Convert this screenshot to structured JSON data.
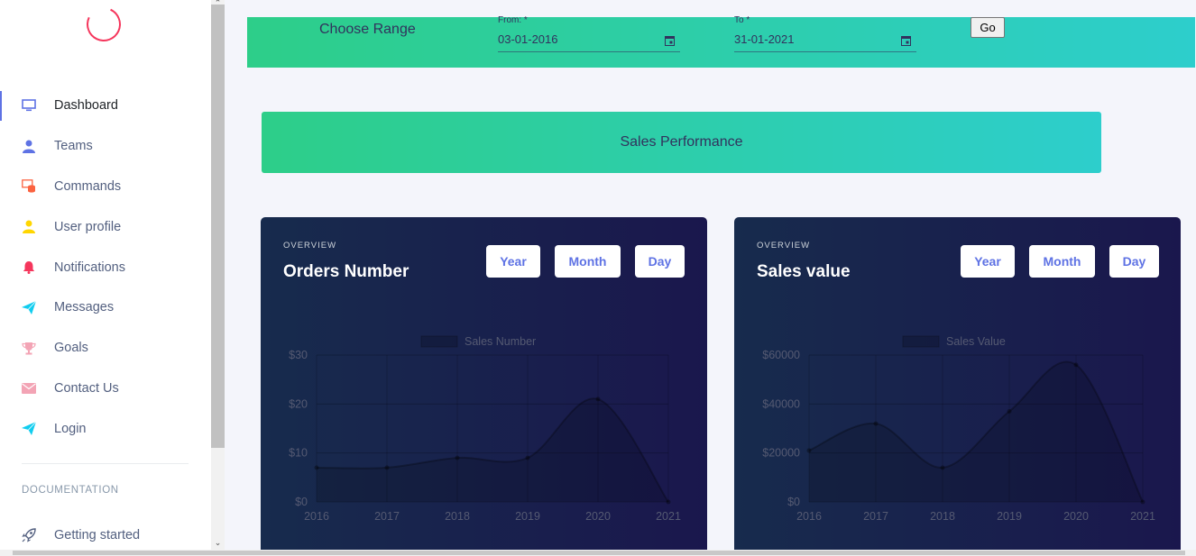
{
  "sidebar": {
    "items": [
      {
        "label": "Dashboard",
        "icon": "tv-icon",
        "color": "#5e72e4",
        "active": true
      },
      {
        "label": "Teams",
        "icon": "user-icon",
        "color": "#5e72e4"
      },
      {
        "label": "Commands",
        "icon": "database-icon",
        "color": "#fb6340"
      },
      {
        "label": "User profile",
        "icon": "user-icon",
        "color": "#ffd600"
      },
      {
        "label": "Notifications",
        "icon": "bell-icon",
        "color": "#f5365c"
      },
      {
        "label": "Messages",
        "icon": "send-icon",
        "color": "#11cdef"
      },
      {
        "label": "Goals",
        "icon": "trophy-icon",
        "color": "#f3a4b5"
      },
      {
        "label": "Contact Us",
        "icon": "email-icon",
        "color": "#f3a4b5"
      },
      {
        "label": "Login",
        "icon": "send-icon",
        "color": "#11cdef"
      }
    ],
    "doc_heading": "DOCUMENTATION",
    "doc_items": [
      {
        "label": "Getting started",
        "icon": "rocket-icon"
      }
    ]
  },
  "range": {
    "title": "Choose Range",
    "from_label": "From: *",
    "from_value": "03-01-2016",
    "to_label": "To *",
    "to_value": "31-01-2021",
    "go_label": "Go"
  },
  "performance": {
    "title": "Sales Performance"
  },
  "cards": [
    {
      "overline": "OVERVIEW",
      "title": "Orders Number",
      "buttons": [
        "Year",
        "Month",
        "Day"
      ]
    },
    {
      "overline": "OVERVIEW",
      "title": "Sales value",
      "buttons": [
        "Year",
        "Month",
        "Day"
      ]
    }
  ],
  "chart_data": [
    {
      "type": "area",
      "x": [
        "2016",
        "2017",
        "2018",
        "2019",
        "2020",
        "2021"
      ],
      "series": [
        {
          "name": "Sales Number",
          "values": [
            7,
            7,
            9,
            9,
            21,
            0
          ]
        }
      ],
      "ylim": [
        0,
        30
      ],
      "yticks": [
        "$0",
        "$10",
        "$20",
        "$30"
      ],
      "ytick_values": [
        0,
        10,
        20,
        30
      ],
      "grid": true,
      "legend": "top"
    },
    {
      "type": "area",
      "x": [
        "2016",
        "2017",
        "2018",
        "2019",
        "2020",
        "2021"
      ],
      "series": [
        {
          "name": "Sales Value",
          "values": [
            21000,
            32000,
            14000,
            37000,
            56000,
            0
          ]
        }
      ],
      "ylim": [
        0,
        60000
      ],
      "yticks": [
        "$0",
        "$20000",
        "$40000",
        "$60000"
      ],
      "ytick_values": [
        0,
        20000,
        40000,
        60000
      ],
      "grid": true,
      "legend": "top"
    }
  ]
}
